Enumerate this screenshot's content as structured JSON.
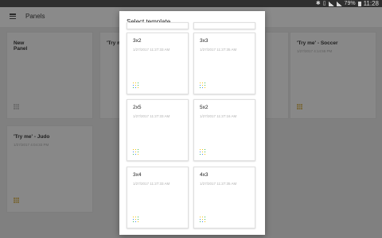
{
  "status_bar": {
    "battery": "79%",
    "time": "11:28"
  },
  "app": {
    "title": "Panels",
    "cards": [
      {
        "title": "New\nPanel",
        "date": ""
      },
      {
        "title": "'Try m",
        "date": ""
      },
      {
        "title": "'Try me' - Soccer",
        "date": "1/27/2017 4:14:55 PM"
      },
      {
        "title": "'Try me' - Judo",
        "date": "1/27/2017 4:04:33 PM"
      }
    ]
  },
  "dialog": {
    "title": "Select template",
    "templates": [
      {
        "name": "3x2",
        "date": "1/27/2017 11:27:33 AM"
      },
      {
        "name": "3x3",
        "date": "1/27/2017 11:27:35 AM"
      },
      {
        "name": "2x5",
        "date": "1/27/2017 11:27:33 AM"
      },
      {
        "name": "5x2",
        "date": "1/27/2017 11:27:16 AM"
      },
      {
        "name": "3x4",
        "date": "1/27/2017 11:27:33 AM"
      },
      {
        "name": "4x3",
        "date": "1/27/2017 11:27:35 AM"
      }
    ]
  },
  "colors": {
    "icon_tiles": [
      "#f4c20d",
      "#f4c20d",
      "#3cba54",
      "#4285f4",
      "#f4c20d",
      "#3cba54",
      "#3cba54",
      "#4285f4",
      "#f4c20d"
    ]
  }
}
